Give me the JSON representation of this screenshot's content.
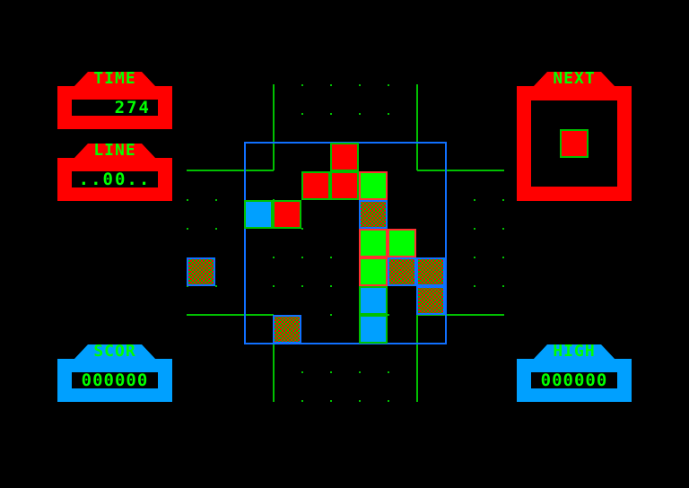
{
  "colors": {
    "background": "#000000",
    "red": "#ff0000",
    "green": "#00ff00",
    "blue": "#00a0ff",
    "grid_line": "#00c000",
    "frame_blue": "#1070ff"
  },
  "time": {
    "label": "TIME",
    "value": "274"
  },
  "line": {
    "label": "LINE",
    "value": "..00.."
  },
  "next": {
    "label": "NEXT",
    "piece_color": "red"
  },
  "score": {
    "label": "SCOR",
    "value": "000000"
  },
  "high": {
    "label": "HIGH",
    "value": "000000"
  },
  "board": {
    "columns": 10,
    "rows": 11,
    "blocks": [
      {
        "col": 5,
        "row": 2,
        "color": "red"
      },
      {
        "col": 4,
        "row": 3,
        "color": "red"
      },
      {
        "col": 5,
        "row": 3,
        "color": "red"
      },
      {
        "col": 6,
        "row": 3,
        "color": "green"
      },
      {
        "col": 2,
        "row": 4,
        "color": "blue"
      },
      {
        "col": 3,
        "row": 4,
        "color": "red"
      },
      {
        "col": 6,
        "row": 4,
        "color": "checker"
      },
      {
        "col": 6,
        "row": 5,
        "color": "green"
      },
      {
        "col": 7,
        "row": 5,
        "color": "green"
      },
      {
        "col": 6,
        "row": 6,
        "color": "green"
      },
      {
        "col": 7,
        "row": 6,
        "color": "checker"
      },
      {
        "col": 8,
        "row": 6,
        "color": "checker"
      },
      {
        "col": 0,
        "row": 6,
        "color": "checker"
      },
      {
        "col": 6,
        "row": 7,
        "color": "blue"
      },
      {
        "col": 8,
        "row": 7,
        "color": "checker"
      },
      {
        "col": 3,
        "row": 8,
        "color": "checker"
      },
      {
        "col": 6,
        "row": 8,
        "color": "blue"
      }
    ]
  }
}
